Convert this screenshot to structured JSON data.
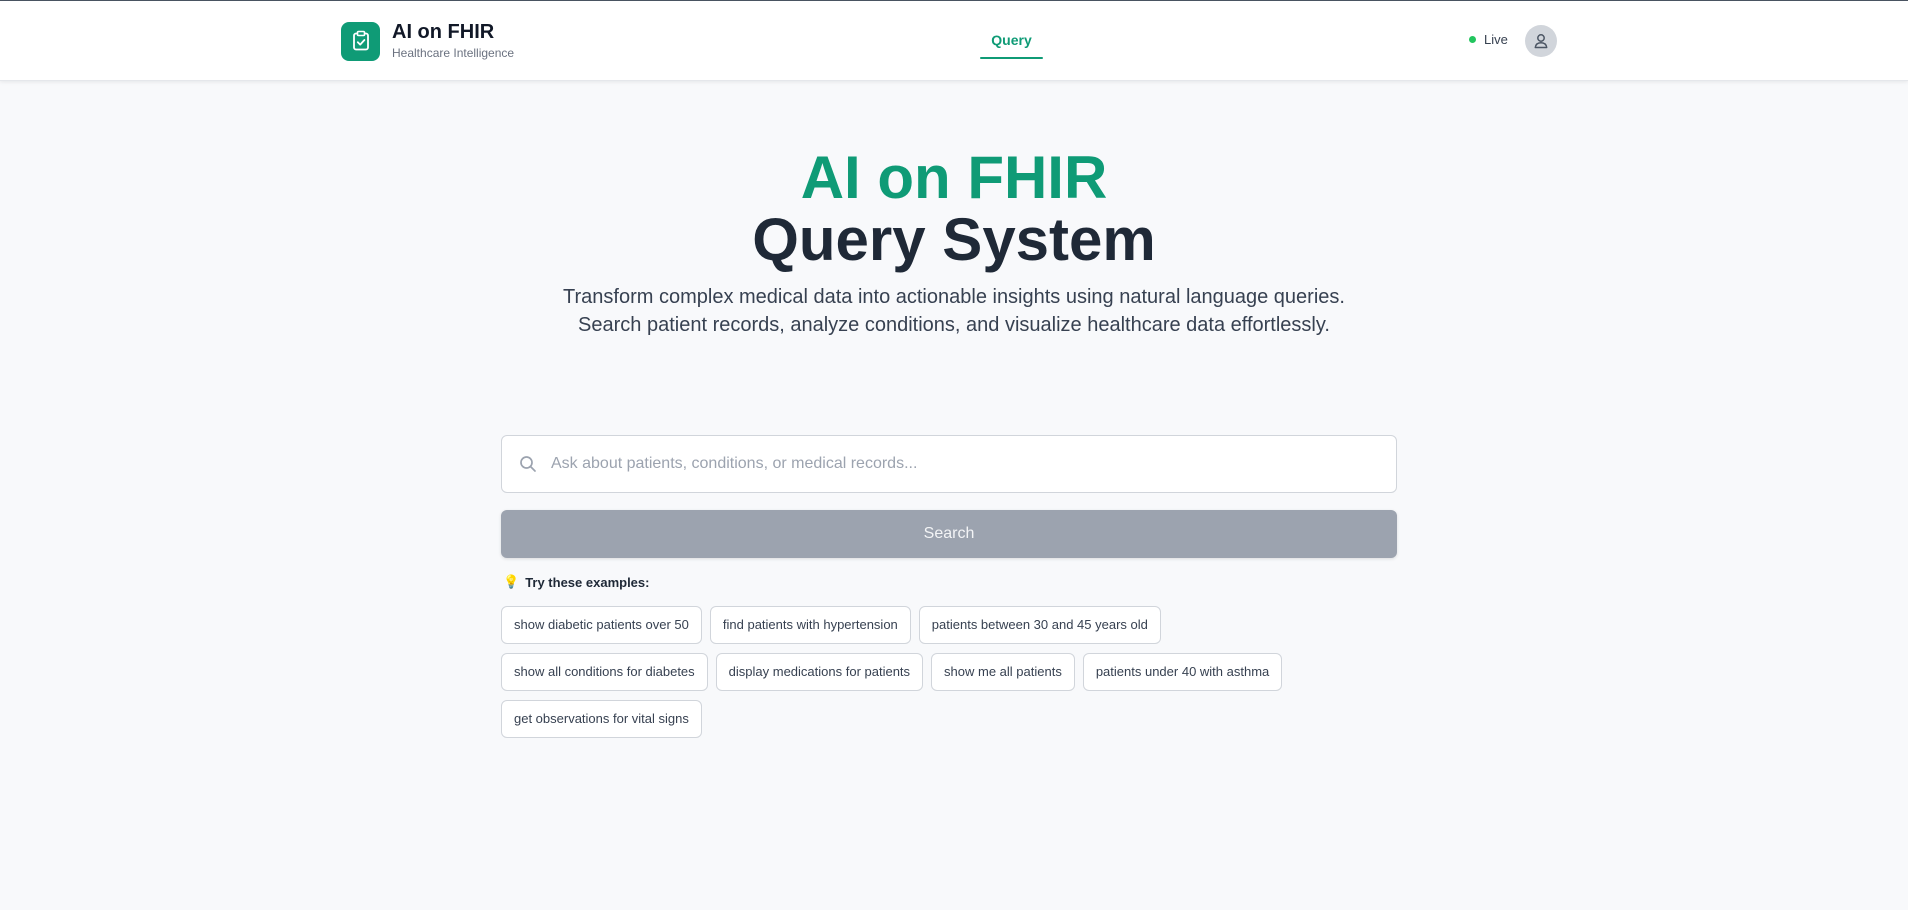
{
  "header": {
    "brand_title": "AI on FHIR",
    "brand_subtitle": "Healthcare Intelligence",
    "nav_tab": "Query",
    "status": "Live"
  },
  "hero": {
    "title_line1": "AI on FHIR",
    "title_line2": "Query System",
    "desc_line1": "Transform complex medical data into actionable insights using natural language queries.",
    "desc_line2": "Search patient records, analyze conditions, and visualize healthcare data effortlessly."
  },
  "search": {
    "placeholder": "Ask about patients, conditions, or medical records...",
    "button_label": "Search"
  },
  "examples": {
    "label": "Try these examples:",
    "items": [
      "show diabetic patients over 50",
      "find patients with hypertension",
      "patients between 30 and 45 years old",
      "show all conditions for diabetes",
      "display medications for patients",
      "show me all patients",
      "patients under 40 with asthma",
      "get observations for vital signs"
    ]
  },
  "colors": {
    "accent": "#0f9b76",
    "status_live": "#22c55e",
    "button_disabled": "#9ca3af"
  },
  "icons": {
    "logo": "clipboard-check-icon",
    "avatar": "user-icon",
    "search": "search-icon",
    "tip": "lightbulb-icon"
  }
}
